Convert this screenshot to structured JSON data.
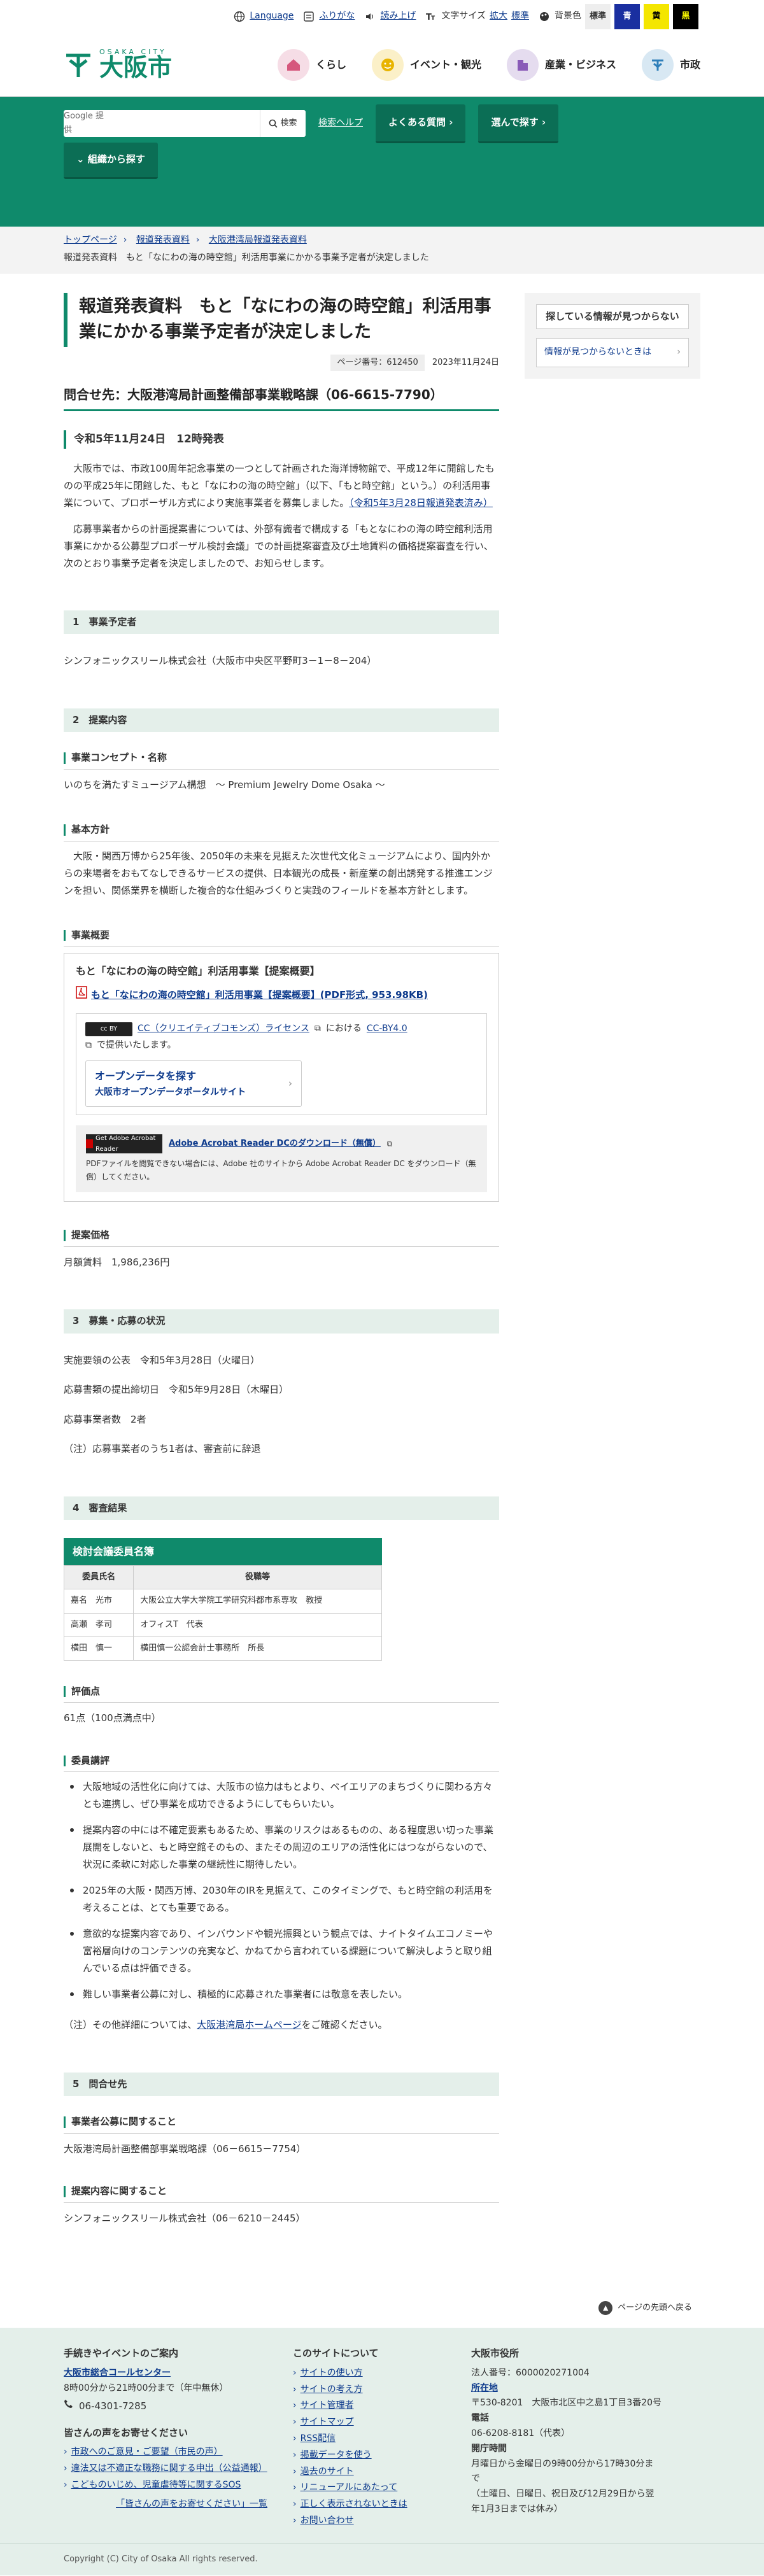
{
  "util": {
    "language": "Language",
    "furigana": "ふりがな",
    "yomiage": "読み上げ",
    "text_size": "文字サイズ",
    "expand": "拡大",
    "standard": "標準",
    "bg_color": "背景色",
    "bg_standard": "標準",
    "bg_blue": "青",
    "bg_yellow": "黄",
    "bg_black": "黒"
  },
  "logo": {
    "sub": "OSAKA CITY",
    "name": "大阪市"
  },
  "gnav": [
    "くらし",
    "イベント・観光",
    "産業・ビジネス",
    "市政"
  ],
  "search": {
    "engine": "Google 提供",
    "button": "検索",
    "help": "検索ヘルプ"
  },
  "greenbar": {
    "faq": "よくある質問",
    "select": "選んで探す",
    "org": "組織から探す"
  },
  "breadcrumb": {
    "items": [
      "トップページ",
      "報道発表資料",
      "大阪港湾局報道発表資料"
    ],
    "current": "報道発表資料　もと「なにわの海の時空館」利活用事業にかかる事業予定者が決定しました"
  },
  "page": {
    "title": "報道発表資料　もと「なにわの海の時空館」利活用事業にかかる事業予定者が決定しました",
    "page_no": "ページ番号：612450",
    "date": "2023年11月24日",
    "contact": "問合せ先：大阪港湾局計画整備部事業戦略課（06-6615-7790）",
    "release": "令和5年11月24日　12時発表",
    "p1": "大阪市では、市政100周年記念事業の一つとして計画された海洋博物館で、平成12年に開館したものの平成25年に閉館した、もと「なにわの海の時空館」（以下、「もと時空館」という。）の利活用事業について、プロポーザル方式により実施事業者を募集しました。",
    "p1_link": "（令和5年3月28日報道発表済み）",
    "p2": "応募事業者からの計画提案書については、外部有識者で構成する「もとなにわの海の時空館利活用事業にかかる公募型プロポーザル検討会議」での計画提案審査及び土地賃料の価格提案審査を行い、次のとおり事業予定者を決定しましたので、お知らせします。"
  },
  "s1": {
    "title": "1　事業予定者",
    "text": "シンフォニックスリール株式会社（大阪市中央区平野町3－1－8－204）"
  },
  "s2": {
    "title": "2　提案内容",
    "concept_h": "事業コンセプト・名称",
    "concept": "いのちを満たすミュージアム構想　～ Premium Jewelry Dome Osaka ～",
    "policy_h": "基本方針",
    "policy": "大阪・関西万博から25年後、2050年の未来を見据えた次世代文化ミュージアムにより、国内外からの来場者をおもてなしできるサービスの提供、日本観光の成長・新産業の創出誘発する推進エンジンを担い、関係業界を横断した複合的な仕組みづくりと実践のフィールドを基本方針とします。",
    "outline_h": "事業概要",
    "panel_title": "もと「なにわの海の時空館」利活用事業【提案概要】",
    "pdf_link": "もと「なにわの海の時空館」利活用事業【提案概要】(PDF形式, 953.98KB)",
    "cc_link": "CC（クリエイティブコモンズ）ライセンス",
    "cc_mid": "における",
    "cc_by": "CC-BY4.0",
    "cc_tail": "で提供いたします。",
    "od_t1": "オープンデータを探す",
    "od_t2": "大阪市オープンデータポータルサイト",
    "adobe_link": "Adobe Acrobat Reader DCのダウンロード（無償）",
    "adobe_text": "PDFファイルを閲覧できない場合には、Adobe 社のサイトから Adobe Acrobat Reader DC をダウンロード（無償）してください。",
    "adobe_logo": "Get Adobe Acrobat Reader",
    "price_h": "提案価格",
    "price": "月額賃料　1,986,236円"
  },
  "s3": {
    "title": "3　募集・応募の状況",
    "l1": "実施要領の公表　令和5年3月28日（火曜日）",
    "l2": "応募書類の提出締切日　令和5年9月28日（木曜日）",
    "l3": "応募事業者数　2者",
    "l4": "（注）応募事業者のうち1者は、審査前に辞退"
  },
  "s4": {
    "title": "4　審査結果",
    "table_title": "検討会議委員名簿",
    "th1": "委員氏名",
    "th2": "役職等",
    "rows": [
      [
        "嘉名　光市",
        "大阪公立大学大学院工学研究科都市系専攻　教授"
      ],
      [
        "高瀬　孝司",
        "オフィスT　代表"
      ],
      [
        "横田　慎一",
        "横田慎一公認会計士事務所　所長"
      ]
    ],
    "score_h": "評価点",
    "score": "61点（100点満点中）",
    "review_h": "委員講評",
    "reviews": [
      "大阪地域の活性化に向けては、大阪市の協力はもとより、ベイエリアのまちづくりに関わる方々とも連携し、ぜひ事業を成功できるようにしてもらいたい。",
      "提案内容の中には不確定要素もあるため、事業のリスクはあるものの、ある程度思い切った事業展開をしないと、もと時空館そのもの、またその周辺のエリアの活性化にはつながらないので、状況に柔軟に対応した事業の継続性に期待したい。",
      "2025年の大阪・関西万博、2030年のIRを見据えて、このタイミングで、もと時空館の利活用を考えることは、とても重要である。",
      "意欲的な提案内容であり、インバウンドや観光振興という観点では、ナイトタイムエコノミーや富裕層向けのコンテンツの充実など、かねてから言われている課題について解決しようと取り組んでいる点は評価できる。",
      "難しい事業者公募に対し、積極的に応募された事業者には敬意を表したい。"
    ],
    "note_pre": "（注）その他詳細については、",
    "note_link": "大阪港湾局ホームページ",
    "note_post": "をご確認ください。"
  },
  "s5": {
    "title": "5　問合せ先",
    "h1": "事業者公募に関すること",
    "t1": "大阪港湾局計画整備部事業戦略課（06－6615－7754）",
    "h2": "提案内容に関すること",
    "t2": "シンフォニックスリール株式会社（06－6210－2445）"
  },
  "side": {
    "h": "探している情報が見つからない",
    "btn": "情報が見つからないときは"
  },
  "pagetop": "ページの先頭へ戻る",
  "footer": {
    "c1_h": "手続きやイベントのご案内",
    "c1_link": "大阪市総合コールセンター",
    "c1_hours": "8時00分から21時00分まで（年中無休）",
    "c1_tel": "06-4301-7285",
    "c1_voice_h": "皆さんの声をお寄せください",
    "c1_links": [
      "市政へのご意見・ご要望（市民の声）",
      "違法又は不適正な職務に関する申出（公益通報）",
      "こどものいじめ、児童虐待等に関するSOS"
    ],
    "c1_all": "「皆さんの声をお寄せください」一覧",
    "c2_h": "このサイトについて",
    "c2_links": [
      "サイトの使い方",
      "サイトの考え方",
      "サイト管理者",
      "サイトマップ",
      "RSS配信",
      "掲載データを使う",
      "過去のサイト",
      "リニューアルにあたって",
      "正しく表示されないときは",
      "お問い合わせ"
    ],
    "c3_h": "大阪市役所",
    "c3_corp": "法人番号：6000020271004",
    "c3_loc_link": "所在地",
    "c3_addr": "〒530-8201　大阪市北区中之島1丁目3番20号",
    "c3_tel_h": "電話",
    "c3_tel": "06-6208-8181（代表）",
    "c3_open_h": "開庁時間",
    "c3_open": "月曜日から金曜日の9時00分から17時30分まで",
    "c3_closed": "（土曜日、日曜日、祝日及び12月29日から翌年1月3日までは休み）"
  },
  "copyright": "Copyright (C) City of Osaka All rights reserved."
}
